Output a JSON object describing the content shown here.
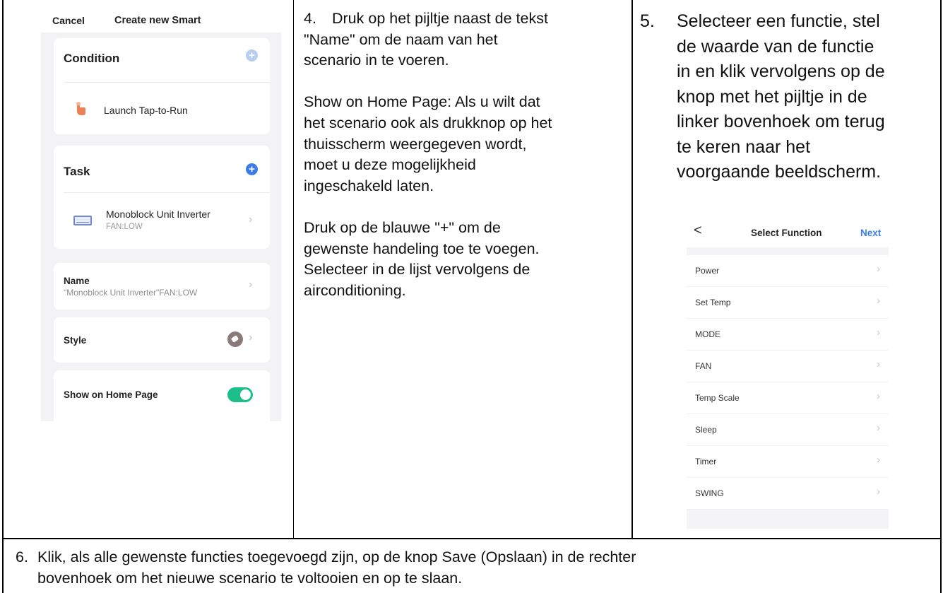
{
  "colors": {
    "accent_blue": "#3b7de8",
    "toggle_green": "#1cbf8a",
    "table_border": "#000000"
  },
  "create_screen": {
    "cancel": "Cancel",
    "title": "Create new Smart",
    "condition": {
      "heading": "Condition",
      "add_icon": "plus-circle-icon",
      "item_icon": "hand-tap-icon",
      "item_label": "Launch Tap-to-Run"
    },
    "task": {
      "heading": "Task",
      "add_icon": "plus-circle-icon",
      "item_icon": "air-conditioner-icon",
      "item_title": "Monoblock Unit Inverter",
      "item_sub": "FAN:LOW"
    },
    "name": {
      "label": "Name",
      "value": "\"Monoblock Unit Inverter\"FAN:LOW"
    },
    "style": {
      "label": "Style",
      "icon": "tag-icon"
    },
    "home_page": {
      "label": "Show on Home Page",
      "enabled": true
    }
  },
  "step4": {
    "number": "4.",
    "line1_rest": "Druk op het pijltje naast de tekst",
    "line2": "\"Name\" om de naam van het",
    "line3": "scenario in te voeren.",
    "para2": [
      "Show on Home Page: Als u wilt dat",
      "het scenario ook als drukknop op het",
      "thuisscherm weergegeven wordt,",
      "moet u deze mogelijkheid",
      "ingeschakeld laten."
    ],
    "para3": [
      "Druk op de blauwe \"+\" om de",
      "gewenste handeling toe te voegen.",
      "Selecteer in de lijst vervolgens de",
      "airconditioning."
    ]
  },
  "step5": {
    "number": "5.",
    "lines": [
      "Selecteer een functie, stel",
      "de waarde van de functie",
      "in en klik vervolgens op de",
      "knop met het pijltje in de",
      "linker bovenhoek om terug",
      "te keren naar het",
      "voorgaande beeldscherm."
    ]
  },
  "select_screen": {
    "back": "<",
    "title": "Select Function",
    "next": "Next",
    "items": [
      "Power",
      "Set Temp",
      "MODE",
      "FAN",
      "Temp Scale",
      "Sleep",
      "Timer",
      "SWING"
    ]
  },
  "step6": {
    "number": "6.",
    "line1": "Klik, als alle gewenste functies toegevoegd zijn, op de knop Save (Opslaan) in de rechter",
    "line2": "bovenhoek om het nieuwe scenario te voltooien en op te slaan."
  }
}
